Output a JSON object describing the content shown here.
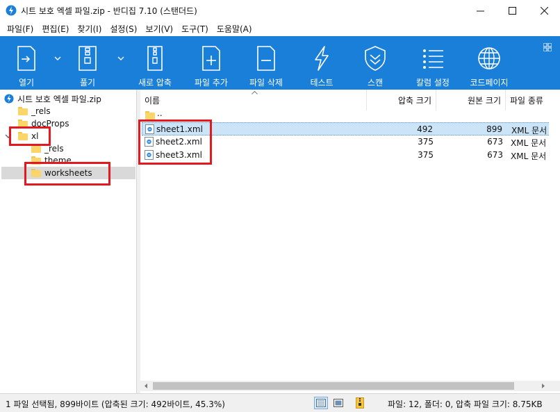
{
  "window": {
    "title": "시트 보호 엑셀 파일.zip - 반디집 7.10 (스탠더드)",
    "accent_color": "#1a7fd8"
  },
  "menu": [
    {
      "label": "파일(F)"
    },
    {
      "label": "편집(E)"
    },
    {
      "label": "찾기(I)"
    },
    {
      "label": "설정(S)"
    },
    {
      "label": "보기(V)"
    },
    {
      "label": "도구(T)"
    },
    {
      "label": "도움말(A)"
    }
  ],
  "toolbar": {
    "open": "열기",
    "extract": "풀기",
    "new_archive": "새로 압축",
    "add_file": "파일 추가",
    "delete_file": "파일 삭제",
    "test": "테스트",
    "scan": "스캔",
    "column_settings": "칼럼 설정",
    "codepage": "코드페이지"
  },
  "tree": {
    "root": "시트 보호 엑셀 파일.zip",
    "items": [
      {
        "label": "_rels"
      },
      {
        "label": "docProps"
      },
      {
        "label": "xl"
      },
      {
        "label": "_rels"
      },
      {
        "label": "theme"
      },
      {
        "label": "worksheets"
      }
    ]
  },
  "list": {
    "columns": {
      "name": "이름",
      "compressed": "압축 크기",
      "original": "원본 크기",
      "type": "파일 종류"
    },
    "parent": "..",
    "rows": [
      {
        "name": "sheet1.xml",
        "compressed": "492",
        "original": "899",
        "type": "XML 문서"
      },
      {
        "name": "sheet2.xml",
        "compressed": "375",
        "original": "673",
        "type": "XML 문서"
      },
      {
        "name": "sheet3.xml",
        "compressed": "375",
        "original": "673",
        "type": "XML 문서"
      }
    ]
  },
  "status": {
    "left": "1 파일 선택됨, 899바이트 (압축된 크기: 492바이트, 45.3%)",
    "right": "파일: 12, 폴더: 0, 압축 파일 크기: 8.75KB"
  }
}
